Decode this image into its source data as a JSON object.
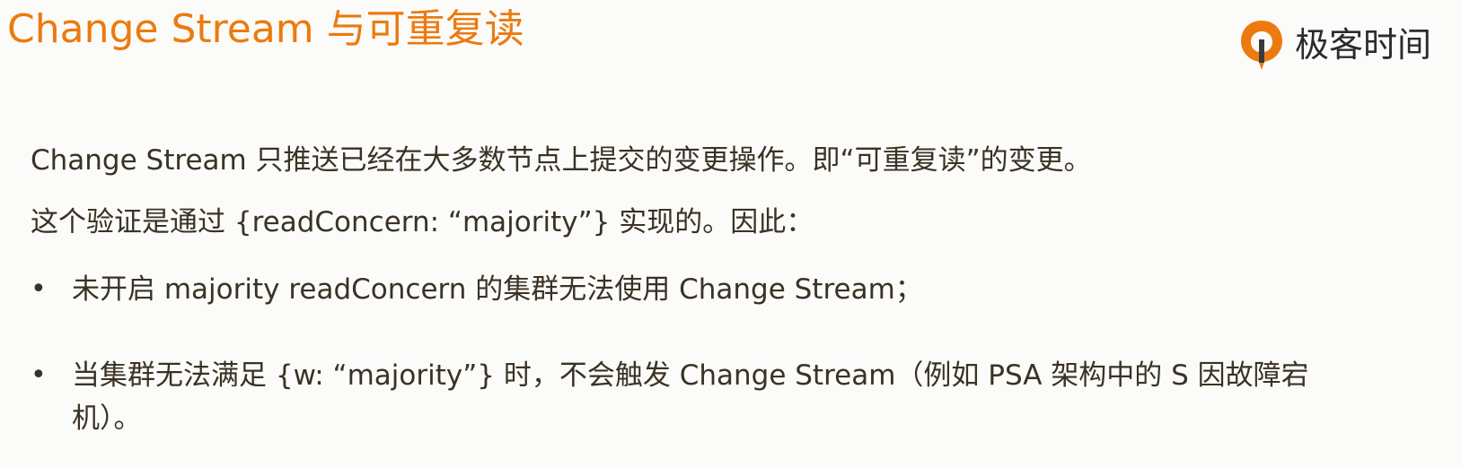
{
  "title": "Change Stream 与可重复读",
  "logo": {
    "text": "极客时间",
    "colors": {
      "orange": "#ec7a0f",
      "dark": "#3a3a3a"
    }
  },
  "paragraphs": [
    "Change Stream 只推送已经在大多数节点上提交的变更操作。即“可重复读”的变更。",
    "这个验证是通过 {readConcern: “majority”} 实现的。因此："
  ],
  "bullets": [
    {
      "marker": "•",
      "text": "未开启 majority readConcern 的集群无法使用 Change Stream；"
    },
    {
      "marker": "•",
      "text": "当集群无法满足 {w: “majority”} 时，不会触发 Change Stream（例如 PSA 架构中的 S 因故障宕机）。"
    }
  ],
  "colors": {
    "title": "#ec7a0f",
    "body_text": "#3a3224",
    "background": "#fbfbf9"
  }
}
